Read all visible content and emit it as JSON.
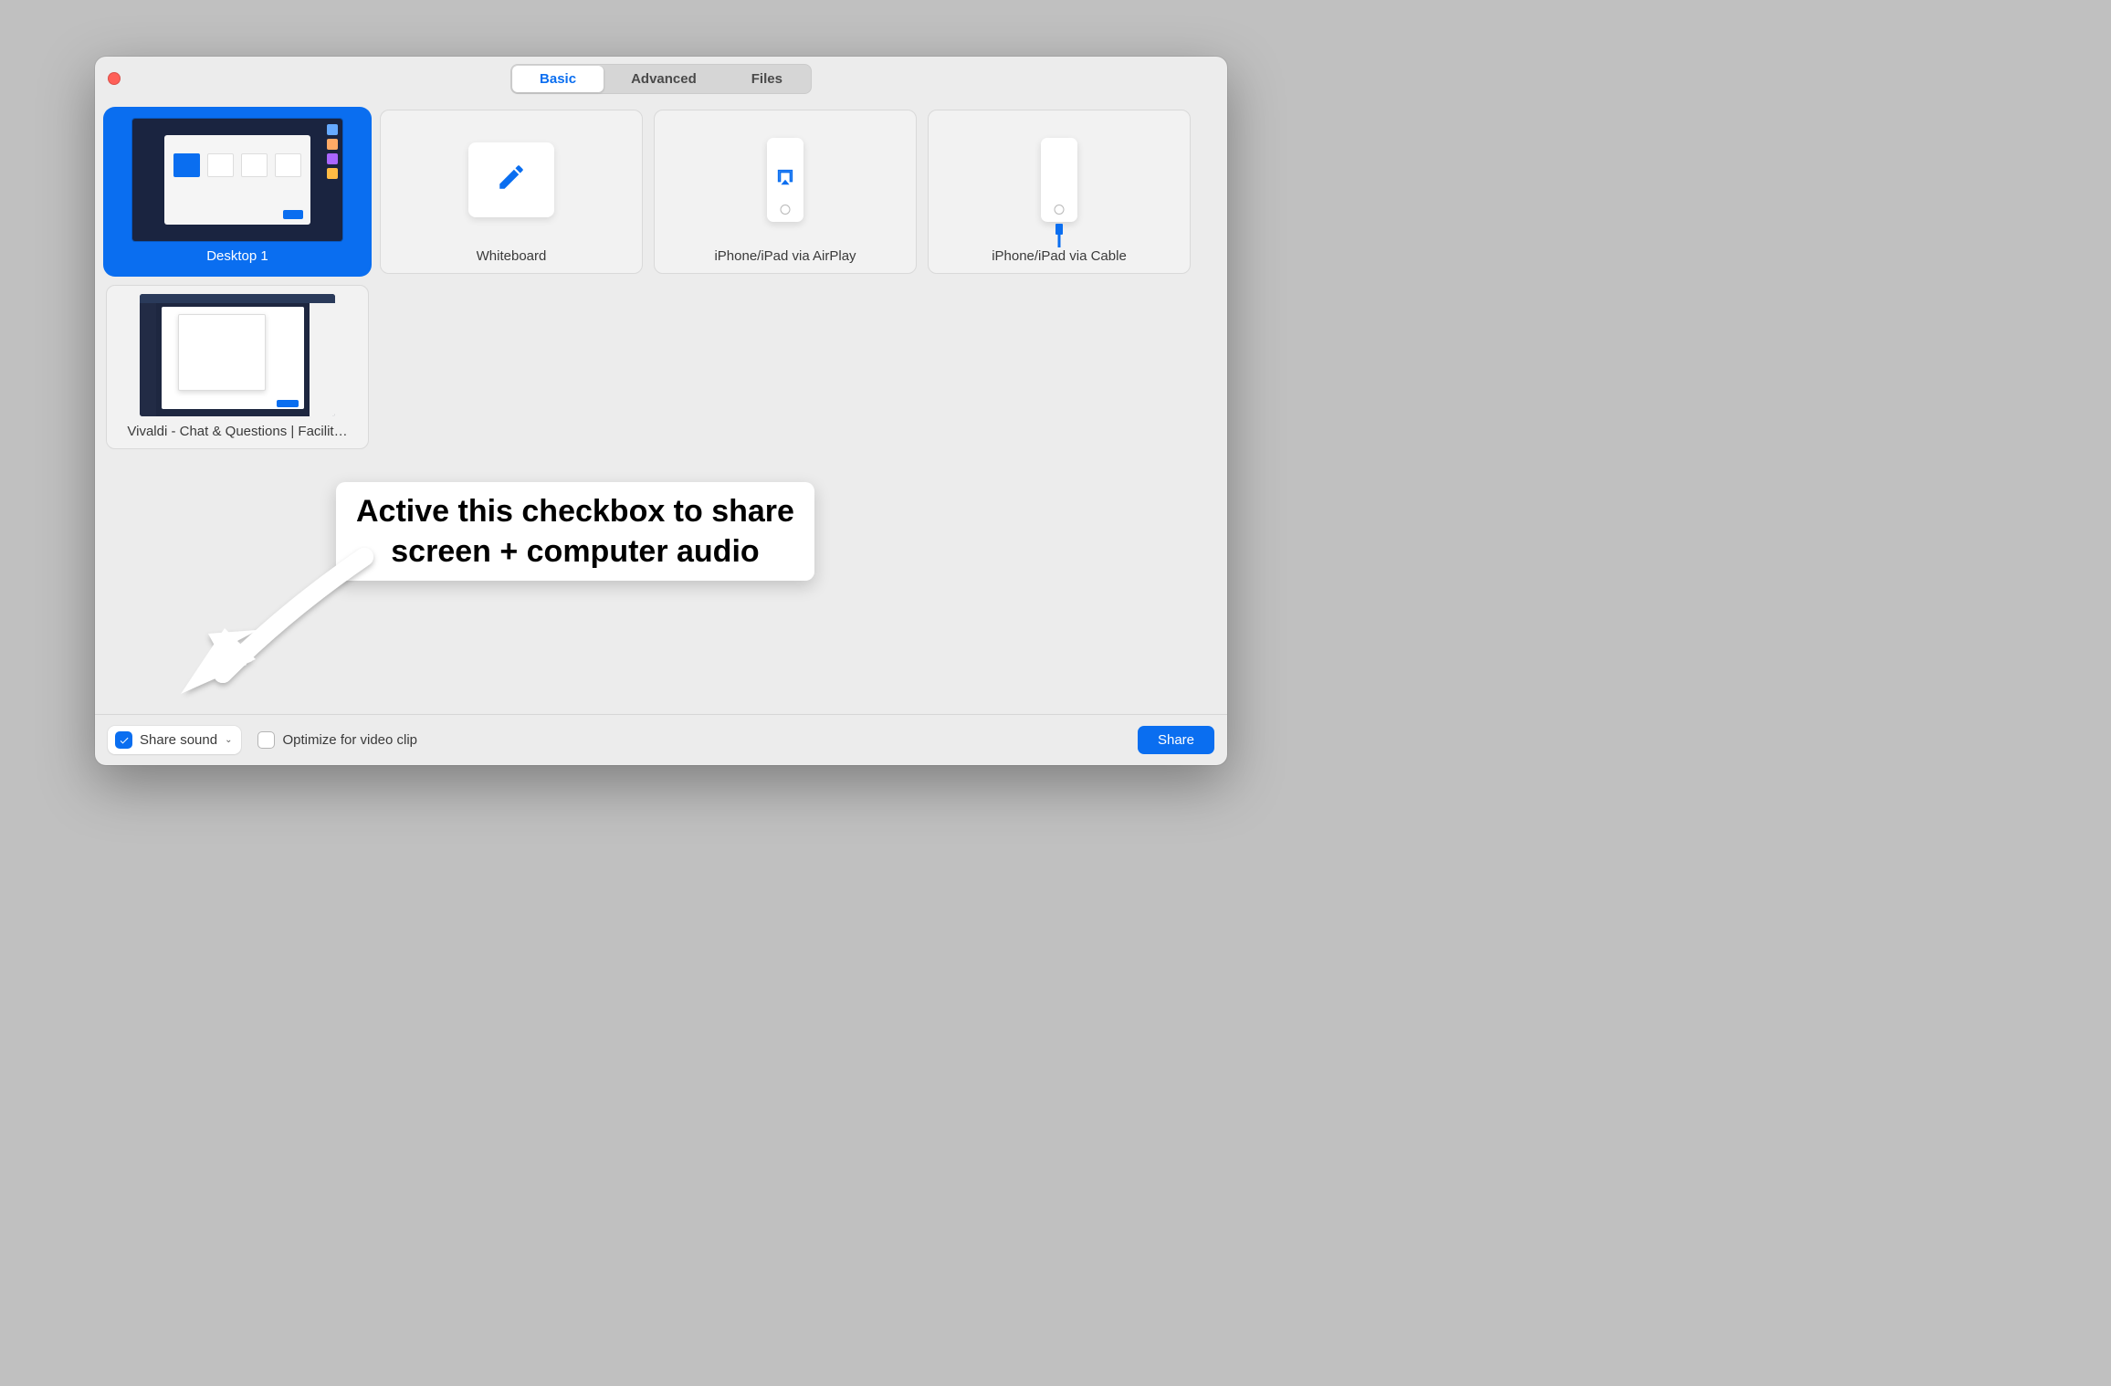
{
  "tabs": {
    "basic": "Basic",
    "advanced": "Advanced",
    "files": "Files",
    "activeIndex": 0
  },
  "cards": {
    "desktop": {
      "label": "Desktop 1",
      "selected": true
    },
    "whiteboard": {
      "label": "Whiteboard"
    },
    "airplay": {
      "label": "iPhone/iPad via AirPlay"
    },
    "cable": {
      "label": "iPhone/iPad via Cable"
    },
    "vivaldi": {
      "label": "Vivaldi - Chat & Questions | Facilit…"
    }
  },
  "footer": {
    "shareSoundLabel": "Share sound",
    "shareSoundChecked": true,
    "optimizeLabel": "Optimize for video clip",
    "optimizeChecked": false,
    "shareButton": "Share"
  },
  "annotation": {
    "line1": "Active this checkbox to share",
    "line2": "screen + computer audio"
  },
  "colors": {
    "accent": "#0a6ef0",
    "windowBg": "#ececec"
  }
}
